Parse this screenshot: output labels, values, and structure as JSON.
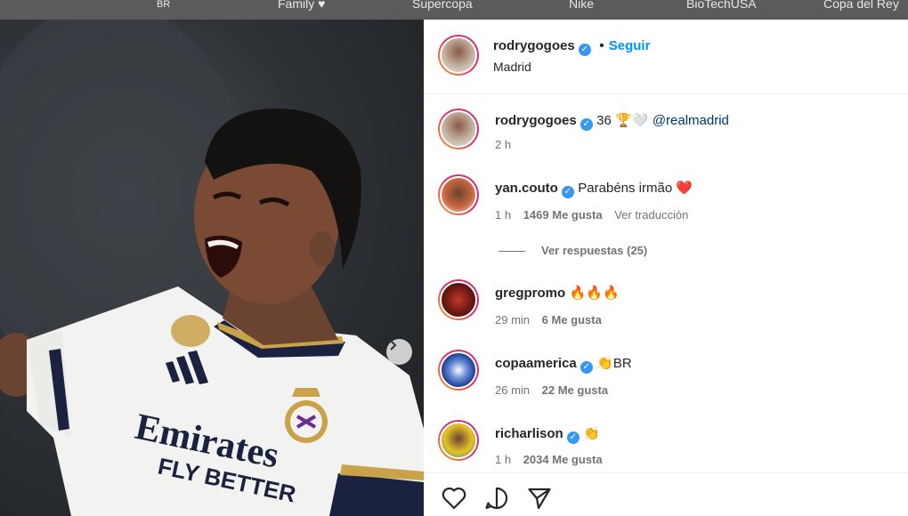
{
  "top_nav": [
    "BR",
    "Family ♥",
    "Supercopa",
    "Nike",
    "BioTechUSA",
    "Copa del Rey"
  ],
  "post": {
    "username": "rodrygogoes",
    "follow_label": "Seguir",
    "location": "Madrid",
    "caption": {
      "username": "rodrygogoes",
      "text": "36 🏆🤍",
      "mention": "@realmadrid",
      "time": "2 h"
    },
    "photo_text": {
      "sponsor": "Emirates",
      "slogan": "FLY BETTER"
    }
  },
  "comments": [
    {
      "username": "yan.couto",
      "verified": true,
      "text": "Parabéns irmão ❤️",
      "time": "1 h",
      "likes": "1469 Me gusta",
      "translate": "Ver traducción",
      "avatar_color": "#c8663f"
    },
    {
      "username": "gregpromo",
      "verified": false,
      "text": "🔥🔥🔥",
      "time": "29 min",
      "likes": "6 Me gusta",
      "avatar_color": "#7a1d16"
    },
    {
      "username": "copaamerica",
      "verified": true,
      "text": "👏BR",
      "time": "26 min",
      "likes": "22 Me gusta",
      "avatar_color": "#1c3f94"
    },
    {
      "username": "richarlison",
      "verified": true,
      "text": "👏",
      "time": "1 h",
      "likes": "2034 Me gusta",
      "avatar_color": "#e8c227"
    }
  ],
  "view_replies": "Ver respuestas (25)",
  "colors": {
    "accent": "#0095f6",
    "verified": "#3897f0",
    "text": "#262626",
    "muted": "#737373"
  },
  "icons": [
    "chevron-right-icon",
    "verified-icon",
    "heart-icon",
    "comment-icon",
    "share-icon"
  ]
}
